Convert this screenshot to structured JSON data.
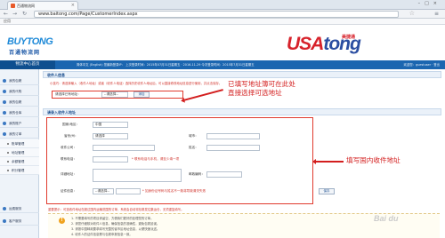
{
  "browser": {
    "tab_title": "百通物流网",
    "url": "www.baitong.com/Page/CustomerIndex.aspx",
    "bookmarks_label": "应用"
  },
  "brand": {
    "logo_en": "BUYTONG",
    "logo_cn": "百通物流网",
    "partner_logo_a": "USA",
    "partner_logo_b": "tong",
    "partner_logo_cn": "美捷通"
  },
  "topbar": {
    "home": "物流中心首页",
    "info": "简体中文 (English) 您最新登录IP：     上次登录时间：2015年07月31日星期五 · 2016-11-29    今次登录时间：2015年7月31日星期五",
    "user": "欢迎您：guestuser · 登出"
  },
  "sidebar": {
    "items": [
      {
        "label": "我的包裹"
      },
      {
        "label": "我的代购"
      },
      {
        "label": "我的包裹"
      },
      {
        "label": "我的仓库"
      },
      {
        "label": "我的账户"
      },
      {
        "label": "我的订单"
      }
    ],
    "subitems": [
      {
        "label": "账单管理"
      },
      {
        "label": "地址管理"
      },
      {
        "label": "余额管理"
      },
      {
        "label": "积分管理"
      }
    ],
    "bottom_items": [
      {
        "label": "运费服务"
      },
      {
        "label": "客户服务"
      }
    ]
  },
  "form": {
    "sender_section": "收件人信息",
    "hint": "小技巧：请选择输入（收件人地址）或者（收件人电话）选择历史收件人地址后，可以直接修改地址信息进行使用，并点击保存。",
    "select_label": "请选择已有地址：",
    "select_value": "--请选择--",
    "add_button": "添加",
    "recipient_section": "请录入收件人地址",
    "country_label": "国家/地区：",
    "country_value": "中国",
    "province_label": "省份/州：",
    "province_value": "请选择",
    "city_label": "城市：",
    "consignee_label": "收件公司：",
    "name_label": "姓名：",
    "phone_label": "联系电话：",
    "phone_hint": "*  联系电话与手机，请至少填一项",
    "address_label": "详细地址：",
    "zip_label": "邮政编码：",
    "id_label": "证件信息：",
    "id_type": "--请选择--",
    "id_hint": "*  如身份证号码与姓名不一致将导致清关失败",
    "save_button": "保存",
    "note": "重要提示：可选收件地址在超过国内运输范围的订单，系统会自动将包裹发往集运仓，无须重复填写。"
  },
  "annotations": {
    "top_line1": "已填写地址簿可在此处",
    "top_line2": "直接选择可选地址",
    "middle": "填写国内收件地址"
  },
  "tips": {
    "items": [
      "1. 不需要填写的项目请留空，方便我们更好的处理您的订单。",
      "2. 请您仔细核对收件人信息，确保信息的准确性，避免包裹延误。",
      "3. 请按中国邮政要求填写完整的省市区地址信息，以便快速派送。",
      "4. 收件人的证件信息需与包裹申报信息一致。"
    ]
  },
  "watermark": "Bai du"
}
